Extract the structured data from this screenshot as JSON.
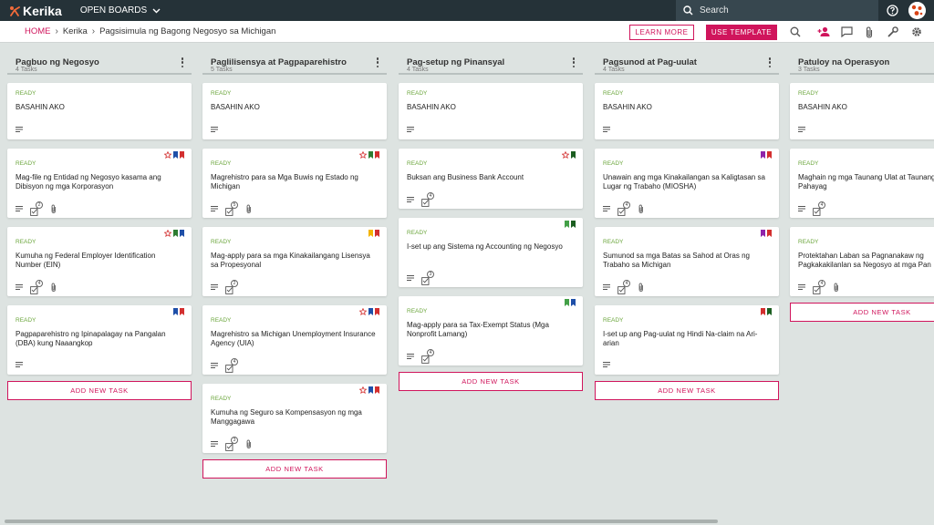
{
  "app": {
    "brand": "Kerika",
    "open_boards": "OPEN BOARDS",
    "search_placeholder": "Search"
  },
  "breadcrumb": {
    "home": "HOME",
    "account": "Kerika",
    "board": "Pagsisimula ng Bagong Negosyo sa Michigan"
  },
  "buttons": {
    "learn_more": "LEARN MORE",
    "use_template": "USE TEMPLATE",
    "add_task": "ADD NEW TASK"
  },
  "columns": [
    {
      "title": "Pagbuo ng Negosyo",
      "count": "4 Tasks",
      "cards": [
        {
          "status": "READY",
          "title": "BASAHIN AKO",
          "star": false,
          "flags": [],
          "checklist": null,
          "attachment": false
        },
        {
          "status": "READY",
          "title": "Mag-file ng Entidad ng Negosyo kasama ang Dibisyon ng mga Korporasyon",
          "star": true,
          "flags": [
            "#1e4fa8",
            "#d32f2f"
          ],
          "checklist": "2",
          "attachment": true
        },
        {
          "status": "READY",
          "title": "Kumuha ng Federal Employer Identification Number (EIN)",
          "star": true,
          "flags": [
            "#2e7d32",
            "#1e4fa8"
          ],
          "checklist": "4",
          "attachment": true
        },
        {
          "status": "READY",
          "title": "Pagpaparehistro ng Ipinapalagay na Pangalan (DBA) kung Naaangkop",
          "star": false,
          "flags": [
            "#1e4fa8",
            "#d32f2f"
          ],
          "checklist": null,
          "attachment": false
        }
      ]
    },
    {
      "title": "Paglilisensya at Pagpaparehistro",
      "count": "5 Tasks",
      "cards": [
        {
          "status": "READY",
          "title": "BASAHIN AKO",
          "star": false,
          "flags": [],
          "checklist": null,
          "attachment": false
        },
        {
          "status": "READY",
          "title": "Magrehistro para sa Mga Buwis ng Estado ng Michigan",
          "star": true,
          "flags": [
            "#2e7d32",
            "#d32f2f"
          ],
          "checklist": "5",
          "attachment": true
        },
        {
          "status": "READY",
          "title": "Mag-apply para sa mga Kinakailangang Lisensya sa Propesyonal",
          "star": false,
          "flags": [
            "#f4b400",
            "#d32f2f"
          ],
          "checklist": "2",
          "attachment": false
        },
        {
          "status": "READY",
          "title": "Magrehistro sa Michigan Unemployment Insurance Agency (UIA)",
          "star": true,
          "flags": [
            "#1e4fa8",
            "#d32f2f"
          ],
          "checklist": "4",
          "attachment": false
        },
        {
          "status": "READY",
          "title": "Kumuha ng Seguro sa Kompensasyon ng mga Manggagawa",
          "star": true,
          "flags": [
            "#1e4fa8",
            "#d32f2f"
          ],
          "checklist": "3",
          "attachment": true
        }
      ]
    },
    {
      "title": "Pag-setup ng Pinansyal",
      "count": "4 Tasks",
      "cards": [
        {
          "status": "READY",
          "title": "BASAHIN AKO",
          "star": false,
          "flags": [],
          "checklist": null,
          "attachment": false
        },
        {
          "status": "READY",
          "title": "Buksan ang Business Bank Account",
          "star": true,
          "flags": [
            "#1b5e20"
          ],
          "checklist": "4",
          "attachment": false
        },
        {
          "status": "READY",
          "title": "I-set up ang Sistema ng Accounting ng Negosyo",
          "star": false,
          "flags": [
            "#43a047",
            "#1b5e20"
          ],
          "checklist": "3",
          "attachment": false
        },
        {
          "status": "READY",
          "title": "Mag-apply para sa Tax-Exempt Status (Mga Nonprofit Lamang)",
          "star": false,
          "flags": [
            "#43a047",
            "#1e4fa8"
          ],
          "checklist": "4",
          "attachment": false
        }
      ]
    },
    {
      "title": "Pagsunod at Pag-uulat",
      "count": "4 Tasks",
      "cards": [
        {
          "status": "READY",
          "title": "BASAHIN AKO",
          "star": false,
          "flags": [],
          "checklist": null,
          "attachment": false
        },
        {
          "status": "READY",
          "title": "Unawain ang mga Kinakailangan sa Kaligtasan sa Lugar ng Trabaho (MIOSHA)",
          "star": false,
          "flags": [
            "#8e24aa",
            "#d32f2f"
          ],
          "checklist": "4",
          "attachment": true
        },
        {
          "status": "READY",
          "title": "Sumunod sa mga Batas sa Sahod at Oras ng Trabaho sa Michigan",
          "star": false,
          "flags": [
            "#8e24aa",
            "#d32f2f"
          ],
          "checklist": "4",
          "attachment": true
        },
        {
          "status": "READY",
          "title": "I-set up ang Pag-uulat ng Hindi Na-claim na Ari-arian",
          "star": false,
          "flags": [
            "#d32f2f",
            "#1b5e20"
          ],
          "checklist": null,
          "attachment": false
        }
      ]
    },
    {
      "title": "Patuloy na Operasyon",
      "count": "3 Tasks",
      "cards": [
        {
          "status": "READY",
          "title": "BASAHIN AKO",
          "star": false,
          "flags": [],
          "checklist": null,
          "attachment": false
        },
        {
          "status": "READY",
          "title": "Maghain ng mga Taunang Ulat at Taunang Pahayag",
          "star": false,
          "flags": [],
          "checklist": "4",
          "attachment": false
        },
        {
          "status": "READY",
          "title": "Protektahan Laban sa Pagnanakaw ng Pagkakakilanlan sa Negosyo at mga Pan",
          "star": false,
          "flags": [],
          "checklist": "4",
          "attachment": true
        }
      ]
    }
  ],
  "colors": {
    "topbar": "#253238",
    "accent": "#d0155c",
    "status_ready": "#6ba63c",
    "board_background": "#dde3e1"
  }
}
